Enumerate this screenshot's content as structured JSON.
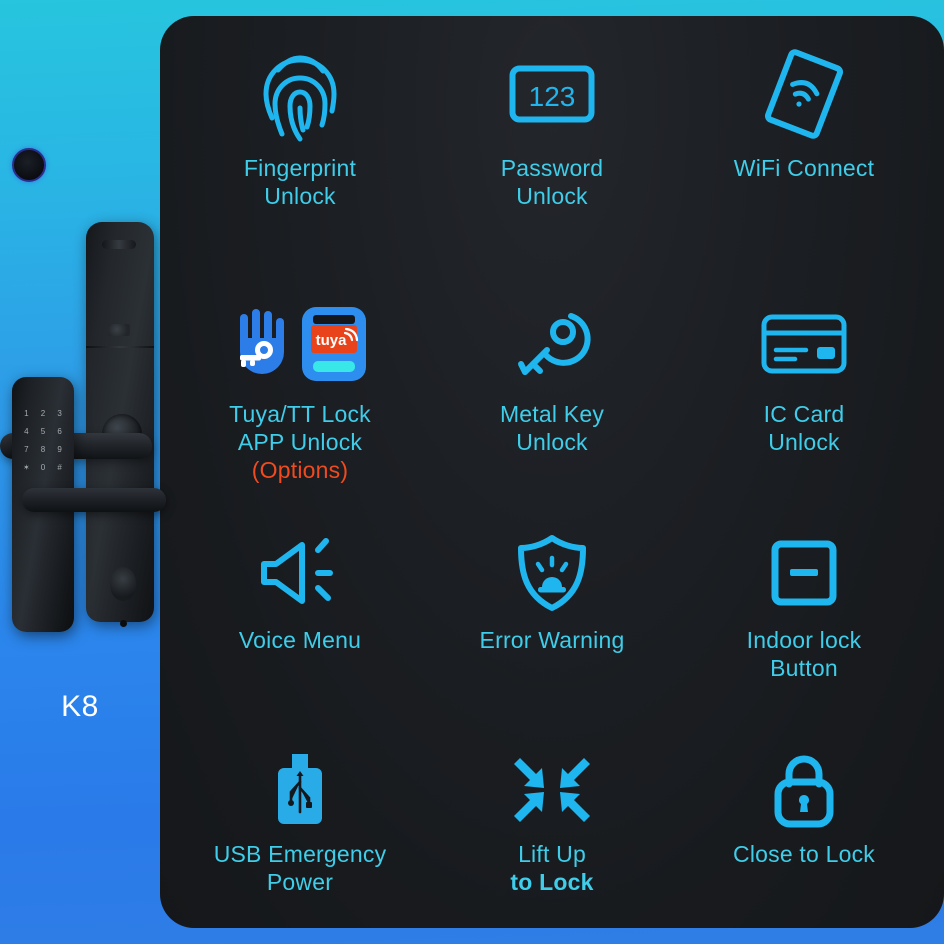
{
  "product": {
    "model_label": "K8",
    "device_name": "smart-door-lock",
    "keypad_keys": [
      "1",
      "2",
      "3",
      "4",
      "5",
      "6",
      "7",
      "8",
      "9",
      "✶",
      "0",
      "#"
    ]
  },
  "panel": {
    "accent_color": "#3fcde9",
    "highlight_color": "#f04a1e",
    "background_color": "#1b1e22",
    "page_background_top": "#27c5de",
    "page_background_bottom": "#2f7ee6"
  },
  "features": [
    {
      "icon": "fingerprint-icon",
      "line1": "Fingerprint",
      "line2": "Unlock",
      "line3": ""
    },
    {
      "icon": "password-123-icon",
      "line1": "Password",
      "line2": "Unlock",
      "line3": ""
    },
    {
      "icon": "wifi-phone-icon",
      "line1": "WiFi Connect",
      "line2": "",
      "line3": ""
    },
    {
      "icon": "tuya-tt-app-icon",
      "line1": "Tuya/TT Lock",
      "line2": "APP Unlock",
      "line3": "(Options)"
    },
    {
      "icon": "metal-key-icon",
      "line1": "Metal Key",
      "line2": "Unlock",
      "line3": ""
    },
    {
      "icon": "ic-card-icon",
      "line1": "IC Card",
      "line2": "Unlock",
      "line3": ""
    },
    {
      "icon": "speaker-icon",
      "line1": "Voice Menu",
      "line2": "",
      "line3": ""
    },
    {
      "icon": "shield-alarm-icon",
      "line1": "Error Warning",
      "line2": "",
      "line3": ""
    },
    {
      "icon": "minus-square-icon",
      "line1": "Indoor lock",
      "line2": "Button",
      "line3": ""
    },
    {
      "icon": "usb-plug-icon",
      "line1": "USB Emergency",
      "line2": "Power",
      "line3": ""
    },
    {
      "icon": "arrows-inward-icon",
      "line1": "Lift Up",
      "line2": "to Lock",
      "line3": ""
    },
    {
      "icon": "padlock-icon",
      "line1": "Close to Lock",
      "line2": "",
      "line3": ""
    }
  ],
  "tuya_icon": {
    "wordmark": "tuya",
    "brand_orange": "#e8431a",
    "brand_blue": "#2e8ef0",
    "bar_cyan": "#38e8e8"
  }
}
